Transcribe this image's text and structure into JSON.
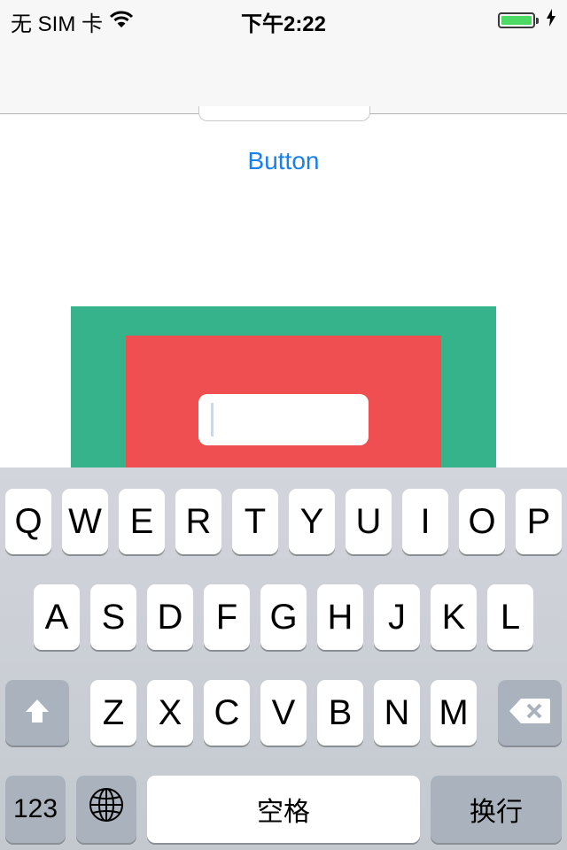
{
  "status_bar": {
    "carrier": "无 SIM 卡",
    "time": "下午2:22",
    "battery_level": 1.0,
    "wifi_icon": "wifi-icon",
    "charging_icon": "bolt-icon"
  },
  "main": {
    "button_label": "Button"
  },
  "colors": {
    "outer_view": "#37b38c",
    "inner_view": "#ef4f50",
    "link": "#1a7fe8"
  },
  "keyboard": {
    "row1": [
      "Q",
      "W",
      "E",
      "R",
      "T",
      "Y",
      "U",
      "I",
      "O",
      "P"
    ],
    "row2": [
      "A",
      "S",
      "D",
      "F",
      "G",
      "H",
      "J",
      "K",
      "L"
    ],
    "row3": [
      "Z",
      "X",
      "C",
      "V",
      "B",
      "N",
      "M"
    ],
    "shift_icon": "shift-arrow-icon",
    "delete_icon": "backspace-icon",
    "numbers_label": "123",
    "globe_icon": "globe-icon",
    "space_label": "空格",
    "return_label": "换行"
  }
}
